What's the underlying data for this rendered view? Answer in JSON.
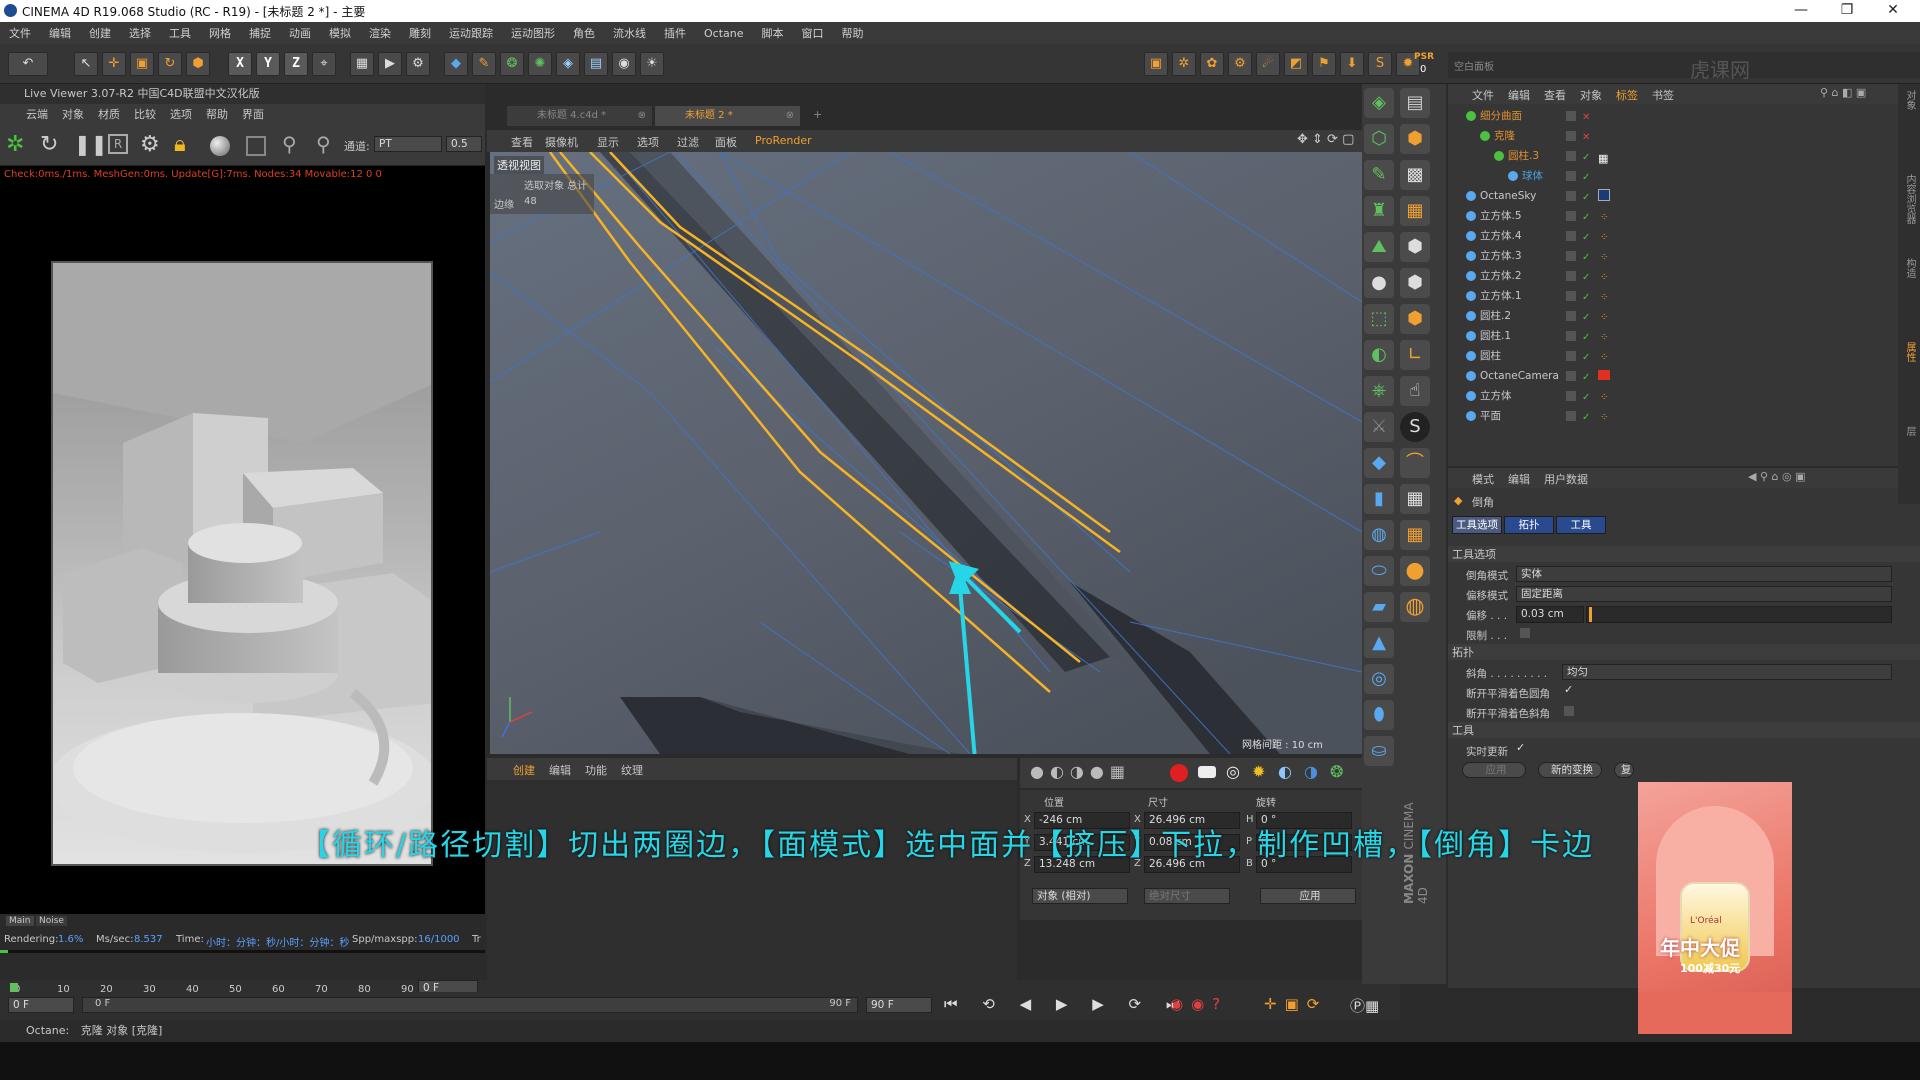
{
  "window": {
    "title": "CINEMA 4D R19.068 Studio (RC - R19) - [未标题 2 *] - 主要",
    "minimize": "—",
    "restore": "❐",
    "close": "✕"
  },
  "menubar": [
    "文件",
    "编辑",
    "创建",
    "选择",
    "工具",
    "网格",
    "捕捉",
    "动画",
    "模拟",
    "渲染",
    "雕刻",
    "运动跟踪",
    "运动图形",
    "角色",
    "流水线",
    "插件",
    "Octane",
    "脚本",
    "窗口",
    "帮助"
  ],
  "toolbar_right": {
    "psr": "PSR",
    "psr_count": "0"
  },
  "live_viewer": {
    "title": "Live Viewer 3.07-R2 中国C4D联盟中文汉化版",
    "menu": [
      "云端",
      "对象",
      "材质",
      "比较",
      "选项",
      "帮助",
      "界面"
    ],
    "channel_label": "通道:",
    "channel_value": "PT",
    "channel_num": "0.5",
    "status": "Check:0ms./1ms. MeshGen:0ms. Update[G]:7ms. Nodes:34 Movable:12  0 0",
    "tab_main": "Main",
    "tab_noise": "Noise",
    "rendering_label": "Rendering:",
    "rendering_value": "1.6%",
    "mssec_label": "Ms/sec:",
    "mssec_value": "8.537",
    "time_label": "Time:",
    "time_value": "小时：分钟：秒/小时：分钟：秒",
    "spp_label": "Spp/maxspp:",
    "spp_value": "16/1000",
    "tr": "Tr"
  },
  "viewport": {
    "tabs": [
      {
        "label": "未标题 4.c4d *",
        "active": false
      },
      {
        "label": "未标题 2 *",
        "active": true
      }
    ],
    "add_tab": "+",
    "menu": [
      "查看",
      "摄像机",
      "显示",
      "选项",
      "过滤",
      "面板",
      "ProRender"
    ],
    "view_name": "透视视图",
    "hud_select": "选取对象 总计",
    "hud_edges_label": "边缘",
    "hud_edges_value": "48",
    "grid_spacing": "网格间距 : 10 cm"
  },
  "material_panel": {
    "menu": [
      "创建",
      "编辑",
      "功能",
      "纹理"
    ]
  },
  "coordinates": {
    "headers": [
      "位置",
      "尺寸",
      "旋转"
    ],
    "rows": [
      {
        "axis": "X",
        "pos": "-246 cm",
        "size_axis": "X",
        "size": "26.496 cm",
        "rot_axis": "H",
        "rot": "0 °"
      },
      {
        "axis": "Y",
        "pos": "3.441 cm",
        "size_axis": "Y",
        "size": "0.08 cm",
        "rot_axis": "P",
        "rot": "0 °"
      },
      {
        "axis": "Z",
        "pos": "13.248 cm",
        "size_axis": "Z",
        "size": "26.496 cm",
        "rot_axis": "B",
        "rot": "0 °"
      }
    ],
    "mode1": "对象 (相对)",
    "mode2": "绝对尺寸",
    "apply": "应用"
  },
  "timeline": {
    "ticks": [
      "0",
      "10",
      "20",
      "30",
      "40",
      "50",
      "60",
      "70",
      "80",
      "90"
    ],
    "frame_current": "0 F",
    "frame_start": "0 F",
    "frame_slider": "0 F",
    "frame_end_slider": "90 F",
    "frame_end": "90 F",
    "frame_field": "0 F"
  },
  "statusbar": {
    "label": "Octane:",
    "text": "克隆 对象 [克隆]"
  },
  "object_manager": {
    "header_title": "空白面板",
    "menu": [
      "文件",
      "编辑",
      "查看",
      "对象",
      "标签",
      "书签"
    ],
    "objects": [
      {
        "name": "细分曲面",
        "indent": 0,
        "color": "#e09030",
        "tag": ""
      },
      {
        "name": "克隆",
        "indent": 1,
        "color": "#e09030",
        "tag": ""
      },
      {
        "name": "圆柱.3",
        "indent": 2,
        "color": "#e09030",
        "tag": "checker"
      },
      {
        "name": "球体",
        "indent": 3,
        "color": "#4aa0e0",
        "tag": ""
      },
      {
        "name": "OctaneSky",
        "indent": 0,
        "color": "#c8c8c8",
        "tag": "sky"
      },
      {
        "name": "立方体.5",
        "indent": 0,
        "color": "#c8c8c8",
        "tag": "dot"
      },
      {
        "name": "立方体.4",
        "indent": 0,
        "color": "#c8c8c8",
        "tag": "dot"
      },
      {
        "name": "立方体.3",
        "indent": 0,
        "color": "#c8c8c8",
        "tag": "dot"
      },
      {
        "name": "立方体.2",
        "indent": 0,
        "color": "#c8c8c8",
        "tag": "dot"
      },
      {
        "name": "立方体.1",
        "indent": 0,
        "color": "#c8c8c8",
        "tag": "dot"
      },
      {
        "name": "圆柱.2",
        "indent": 0,
        "color": "#c8c8c8",
        "tag": "dot"
      },
      {
        "name": "圆柱.1",
        "indent": 0,
        "color": "#c8c8c8",
        "tag": "dot"
      },
      {
        "name": "圆柱",
        "indent": 0,
        "color": "#c8c8c8",
        "tag": "dot"
      },
      {
        "name": "OctaneCamera",
        "indent": 0,
        "color": "#c8c8c8",
        "tag": "camera"
      },
      {
        "name": "立方体",
        "indent": 0,
        "color": "#c8c8c8",
        "tag": "dot"
      },
      {
        "name": "平面",
        "indent": 0,
        "color": "#c8c8c8",
        "tag": "dot"
      }
    ]
  },
  "attribute_manager": {
    "menu": [
      "模式",
      "编辑",
      "用户数据"
    ],
    "tool_name": "倒角",
    "tabs": [
      "工具选项",
      "拓扑",
      "工具"
    ],
    "section_tool_options": "工具选项",
    "bevel_mode_label": "倒角模式",
    "bevel_mode_value": "实体",
    "offset_mode_label": "偏移模式",
    "offset_mode_value": "固定距离",
    "offset_label": "偏移 . . .",
    "offset_value": "0.03 cm",
    "limit_label": "限制 . . .",
    "section_topology": "拓扑",
    "miter_label": "斜角 . . . . . . . . .",
    "miter_value": "均匀",
    "break_phong_round_label": "断开平滑着色圆角",
    "break_phong_miter_label": "断开平滑着色斜角",
    "section_tool": "工具",
    "realtime_label": "实时更新",
    "btn_apply": "应用",
    "btn_new": "新的变换",
    "btn_reset": "复"
  },
  "right_side_tabs": [
    "对象",
    "内容浏览器",
    "构造",
    "属性",
    "层"
  ],
  "maxon": {
    "line1": "MAXON",
    "line2": "CINEMA 4D"
  },
  "subtitle": "【循环/路径切割】切出两圈边，【面模式】选中面并【挤压】下拉，制作凹槽，【倒角】卡边",
  "watermark": "虎课网",
  "ad": {
    "headline": "年中大促",
    "price": "100减30元",
    "brand": "L'Oréal"
  },
  "colors": {
    "accent_orange": "#f0a030",
    "subtitle_cyan": "#27d6e6",
    "selected_edge": "#f5b325",
    "arrow_cyan": "#27d6e6"
  }
}
